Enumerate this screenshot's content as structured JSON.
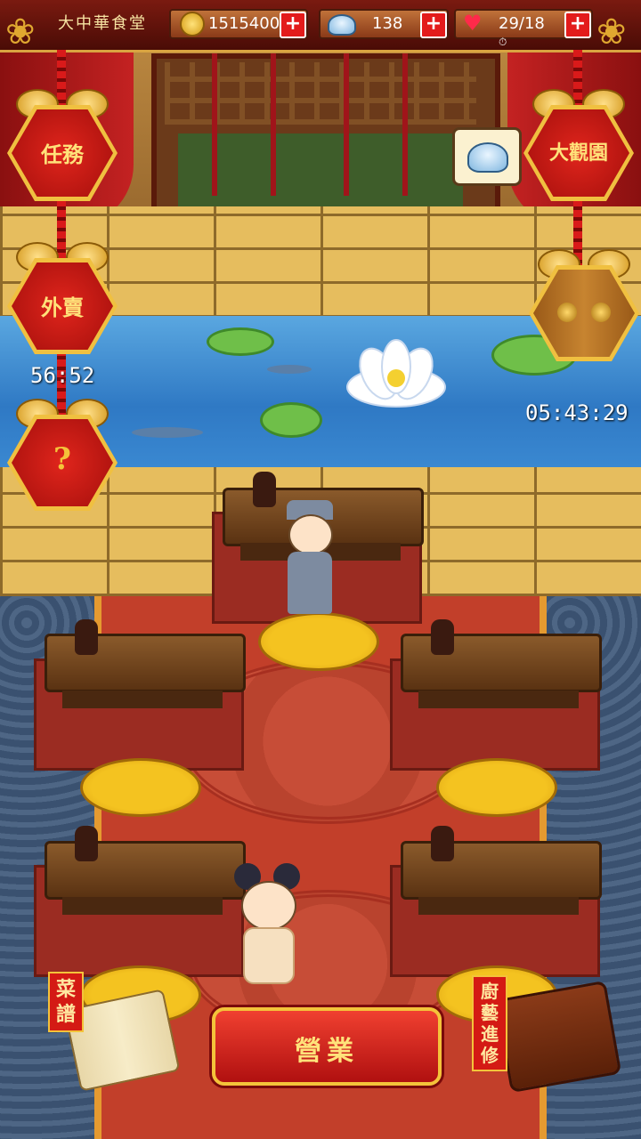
{
  "hud": {
    "title": "大中華食堂",
    "coins": "1515400",
    "ingots": "138",
    "stamina": "29/18",
    "clock_glyph": "⏱",
    "plus_glyph": "+"
  },
  "left_menu": {
    "tasks_label": "任務",
    "delivery_label": "外賣",
    "delivery_timer": "56:52",
    "unknown_label": "?"
  },
  "right_menu": {
    "garden_label": "大觀園",
    "cabinet_timer": "05:43:29"
  },
  "bottom": {
    "recipes_label": "菜譜",
    "open_label": "營業",
    "training_label": "廚藝進修"
  },
  "colors": {
    "accent_red": "#d41a14",
    "gold": "#f4c33a",
    "carpet": "#c23f2a",
    "pond": "#3a88d1"
  },
  "icons": {
    "coin": "coin-icon",
    "ingot": "silver-ingot-icon",
    "heart": "heart-icon",
    "plus": "plus-icon"
  }
}
